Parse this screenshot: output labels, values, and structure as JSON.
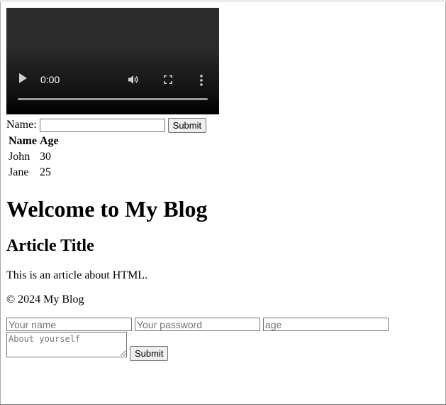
{
  "video": {
    "time": "0:00"
  },
  "name_form": {
    "label": "Name:",
    "value": "",
    "submit": "Submit"
  },
  "table": {
    "headers": [
      "Name",
      "Age"
    ],
    "rows": [
      [
        "John",
        "30"
      ],
      [
        "Jane",
        "25"
      ]
    ]
  },
  "heading": "Welcome to My Blog",
  "article": {
    "title": "Article Title",
    "body": "This is an article about HTML."
  },
  "footer": "© 2024 My Blog",
  "signup_form": {
    "name_placeholder": "Your name",
    "password_placeholder": "Your password",
    "age_placeholder": "age",
    "about_placeholder": "About yourself",
    "submit": "Submit"
  },
  "icons": [
    "play-icon",
    "volume-icon",
    "fullscreen-icon",
    "more-options-icon"
  ]
}
